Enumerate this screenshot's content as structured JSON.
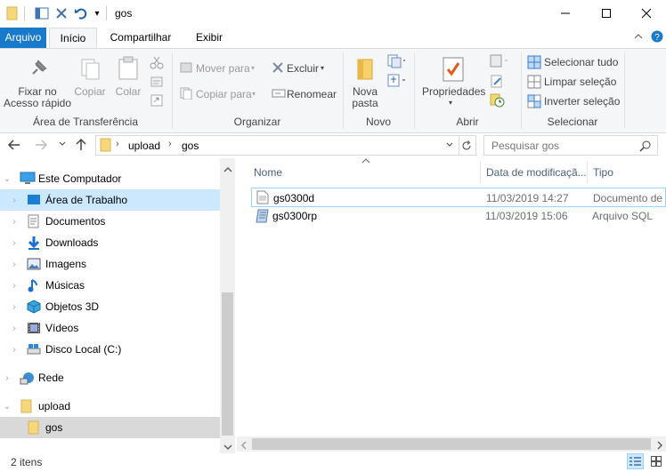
{
  "window": {
    "title": "gos"
  },
  "quick_access": {
    "customize_glyph": "▾"
  },
  "tabs": [
    {
      "label": "Arquivo"
    },
    {
      "label": "Início"
    },
    {
      "label": "Compartilhar"
    },
    {
      "label": "Exibir"
    }
  ],
  "ribbon": {
    "clipboard": {
      "pin_label_1": "Fixar no",
      "pin_label_2": "Acesso rápido",
      "copy_label": "Copiar",
      "paste_label": "Colar",
      "group_label": "Área de Transferência"
    },
    "organize": {
      "move_label": "Mover para",
      "copy_to_label": "Copiar para",
      "delete_label": "Excluir",
      "rename_label": "Renomear",
      "group_label": "Organizar"
    },
    "new": {
      "new_folder_1": "Nova",
      "new_folder_2": "pasta",
      "group_label": "Novo"
    },
    "open": {
      "properties_label": "Propriedades",
      "group_label": "Abrir"
    },
    "select": {
      "select_all": "Selecionar tudo",
      "clear_selection": "Limpar seleção",
      "invert_selection": "Inverter seleção",
      "group_label": "Selecionar"
    }
  },
  "address": {
    "path": [
      "upload",
      "gos"
    ],
    "search_placeholder": "Pesquisar gos"
  },
  "nav": [
    {
      "label": "Este Computador",
      "icon": "computer-icon"
    },
    {
      "label": "Área de Trabalho",
      "icon": "desktop-icon"
    },
    {
      "label": "Documentos",
      "icon": "documents-icon"
    },
    {
      "label": "Downloads",
      "icon": "downloads-icon"
    },
    {
      "label": "Imagens",
      "icon": "pictures-icon"
    },
    {
      "label": "Músicas",
      "icon": "music-icon"
    },
    {
      "label": "Objetos 3D",
      "icon": "objects-3d-icon"
    },
    {
      "label": "Vídeos",
      "icon": "videos-icon"
    },
    {
      "label": "Disco Local (C:)",
      "icon": "drive-icon"
    },
    {
      "label": "Rede",
      "icon": "network-icon"
    },
    {
      "label": "upload",
      "icon": "folder-icon"
    },
    {
      "label": "gos",
      "icon": "folder-icon"
    }
  ],
  "columns": [
    {
      "label": "Nome"
    },
    {
      "label": "Data de modificaçã..."
    },
    {
      "label": "Tipo"
    }
  ],
  "files": [
    {
      "name": "gs0300d",
      "date": "11/03/2019 14:27",
      "type": "Documento de"
    },
    {
      "name": "gs0300rp",
      "date": "11/03/2019 15:06",
      "type": "Arquivo SQL"
    }
  ],
  "status": {
    "item_count": "2 itens"
  },
  "colors": {
    "accent": "#1979ca",
    "selection": "#cce8ff",
    "hover": "#e5f3ff"
  }
}
